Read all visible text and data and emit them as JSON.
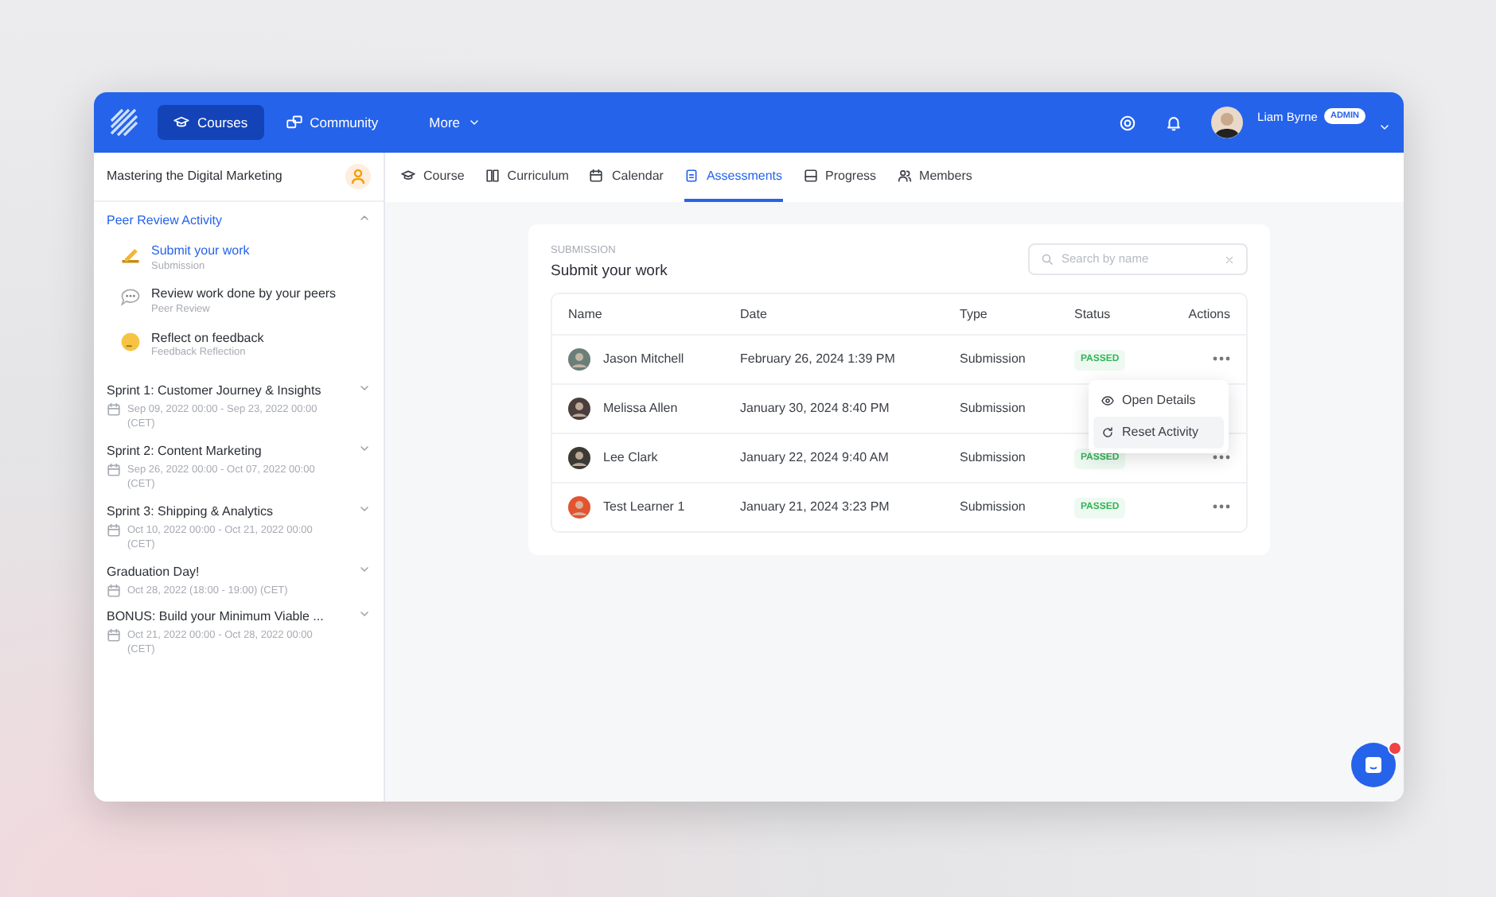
{
  "topbar": {
    "nav": [
      {
        "label": "Courses",
        "selected": true,
        "kind": "courses"
      },
      {
        "label": "Community",
        "selected": false,
        "kind": "community"
      },
      {
        "label": "More",
        "selected": false,
        "kind": "more"
      }
    ],
    "user": {
      "name": "Liam Byrne",
      "role": "ADMIN"
    }
  },
  "sidebar": {
    "course_title": "Mastering the Digital Marketing",
    "sections": [
      {
        "title": "Peer Review Activity",
        "expanded": true,
        "children": [
          {
            "title": "Submit your work",
            "subtitle": "Submission",
            "selected": true,
            "kind": "pencil"
          },
          {
            "title": "Review work done by your peers",
            "subtitle": "Peer Review",
            "selected": false,
            "kind": "chat"
          },
          {
            "title": "Reflect on feedback",
            "subtitle": "Feedback Reflection",
            "selected": false,
            "kind": "think"
          }
        ]
      },
      {
        "title": "Sprint 1: Customer Journey & Insights",
        "expanded": false,
        "date": "Sep 09, 2022 00:00 - Sep 23, 2022 00:00 (CET)"
      },
      {
        "title": "Sprint 2: Content Marketing",
        "expanded": false,
        "date": "Sep 26, 2022 00:00 - Oct 07, 2022 00:00 (CET)"
      },
      {
        "title": "Sprint 3: Shipping & Analytics",
        "expanded": false,
        "date": "Oct 10, 2022 00:00 - Oct 21, 2022 00:00 (CET)"
      },
      {
        "title": "Graduation Day!",
        "expanded": false,
        "date": "Oct 28, 2022 (18:00 - 19:00) (CET)"
      },
      {
        "title": "BONUS: Build your Minimum Viable ...",
        "expanded": false,
        "date": "Oct 21, 2022 00:00 - Oct 28, 2022 00:00 (CET)"
      }
    ]
  },
  "tabs": [
    {
      "label": "Course",
      "selected": false,
      "kind": "course"
    },
    {
      "label": "Curriculum",
      "selected": false,
      "kind": "curriculum"
    },
    {
      "label": "Calendar",
      "selected": false,
      "kind": "calendar"
    },
    {
      "label": "Assessments",
      "selected": true,
      "kind": "assessments"
    },
    {
      "label": "Progress",
      "selected": false,
      "kind": "progress"
    },
    {
      "label": "Members",
      "selected": false,
      "kind": "members"
    }
  ],
  "panel": {
    "eyebrow": "SUBMISSION",
    "title": "Submit your work",
    "search": {
      "placeholder": "Search by name"
    },
    "table": {
      "columns": [
        "Name",
        "Date",
        "Type",
        "Status",
        "Actions"
      ],
      "rows": [
        {
          "name": "Jason Mitchell",
          "date": "February 26, 2024 1:39 PM",
          "type": "Submission",
          "status": "PASSED",
          "actions": true
        },
        {
          "name": "Melissa Allen",
          "date": "January 30, 2024 8:40 PM",
          "type": "Submission",
          "actions": false
        },
        {
          "name": "Lee Clark",
          "date": "January 22, 2024 9:40 AM",
          "type": "Submission",
          "status": "PASSED",
          "actions": true
        },
        {
          "name": "Test Learner 1",
          "date": "January 21, 2024 3:23 PM",
          "type": "Submission",
          "status": "PASSED",
          "actions": true
        }
      ]
    },
    "menu": [
      {
        "label": "Open Details",
        "kind": "eye",
        "selected": false
      },
      {
        "label": "Reset Activity",
        "kind": "reset",
        "selected": true
      }
    ]
  }
}
